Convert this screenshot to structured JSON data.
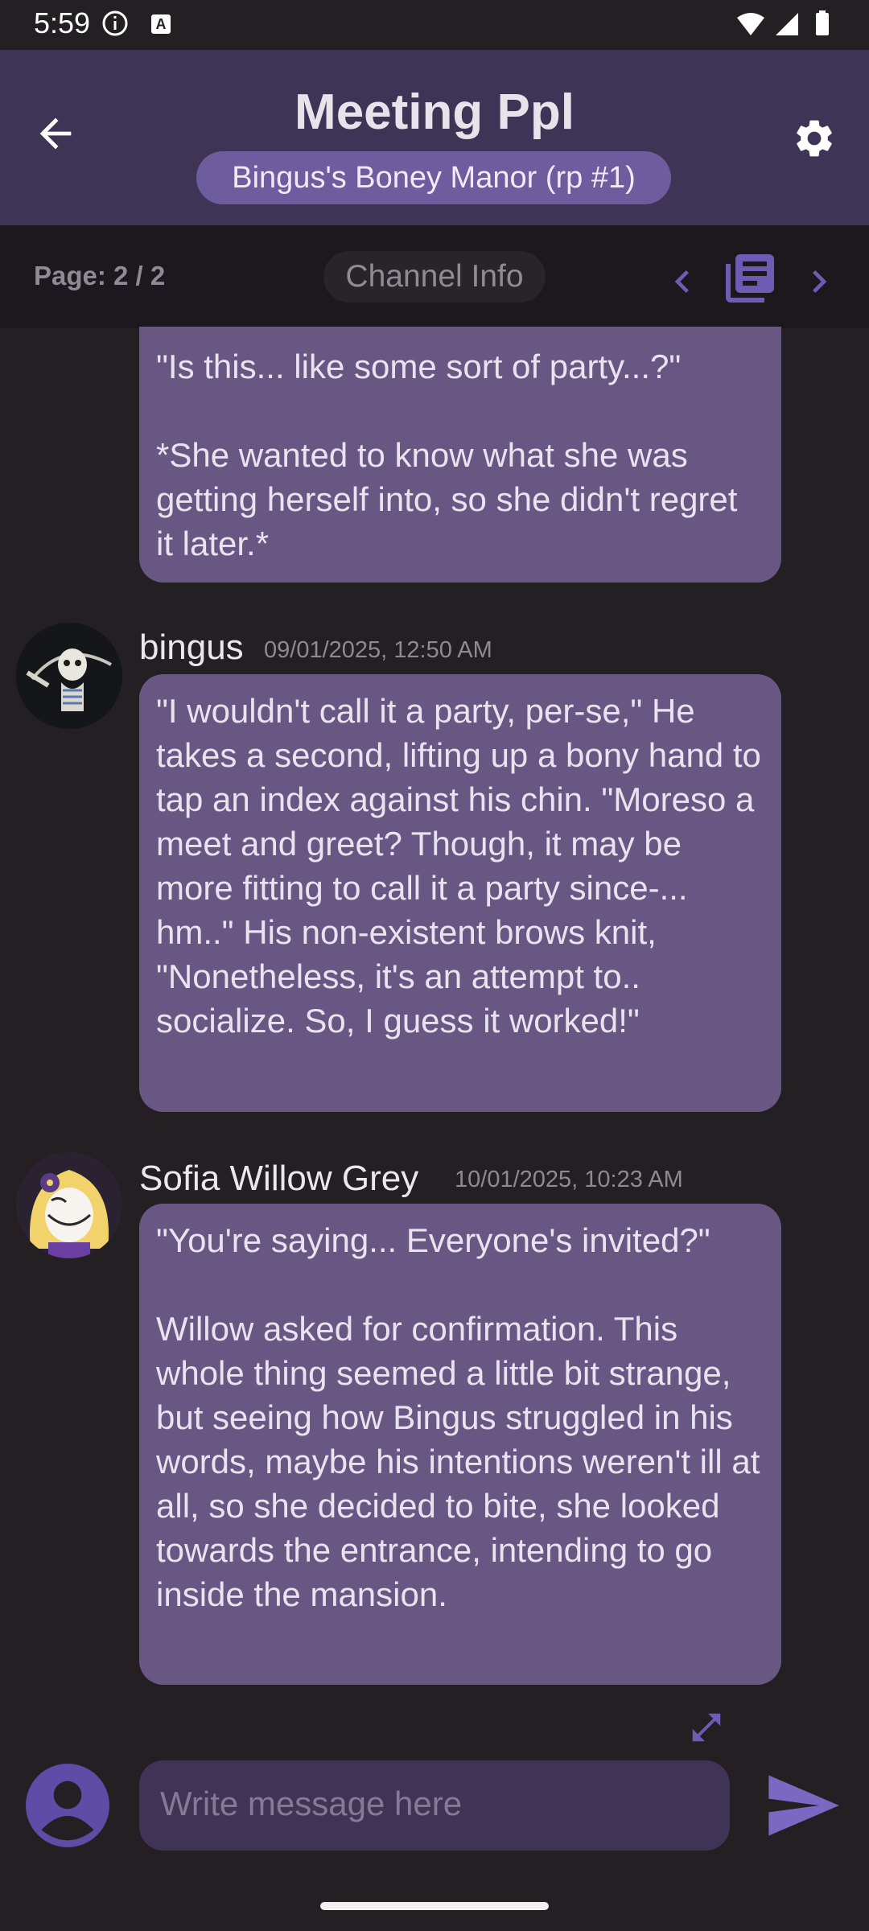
{
  "status_bar": {
    "time": "5:59",
    "badge": "A"
  },
  "header": {
    "title": "Meeting Ppl",
    "channel_chip": "Bingus's Boney Manor (rp #1)",
    "icons": {
      "back": "arrow-back-icon",
      "settings": "gear-icon"
    }
  },
  "page_bar": {
    "page_label": "Page: 2 / 2",
    "channel_info_label": "Channel Info",
    "icons": {
      "prev": "chevron-left-icon",
      "pages": "library-books-icon",
      "next": "chevron-right-icon"
    }
  },
  "messages": [
    {
      "text": "\"Is this... like some sort of party...?\"\n\n*She wanted to know what she was getting herself into, so she didn't regret it later.*"
    },
    {
      "author": "bingus",
      "timestamp": "09/01/2025, 12:50 AM",
      "text": "\"I wouldn't call it a party, per-se,\" He takes a second, lifting up a bony hand to tap an index against his chin. \"Moreso a meet and greet? Though, it may be more fitting to call it a party since-... hm..\" His non-existent brows knit, \"Nonetheless, it's an attempt to.. socialize. So, I guess it worked!\""
    },
    {
      "author": "Sofia Willow Grey",
      "timestamp": "10/01/2025, 10:23 AM",
      "text": "\"You're saying... Everyone's invited?\"\n\nWillow asked for confirmation. This whole thing seemed a little bit strange, but seeing how Bingus struggled in his words, maybe his intentions weren't ill at all, so she decided to bite, she looked towards the entrance, intending to go inside the mansion."
    }
  ],
  "composer": {
    "placeholder": "Write message here",
    "icons": {
      "expand": "expand-icon",
      "avatar": "account-circle-icon",
      "send": "send-icon"
    }
  },
  "colors": {
    "background": "#231f23",
    "app_bar": "#3e3456",
    "bubble": "#685783",
    "accent": "#7b68c2"
  }
}
